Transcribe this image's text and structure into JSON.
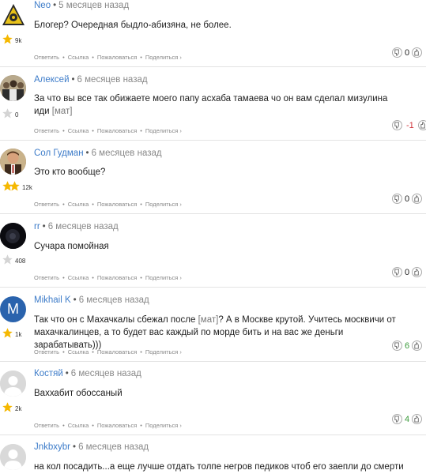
{
  "comments": [
    {
      "author": "Neo",
      "time": "5 месяцев назад",
      "text": "Блогер? Очередная быдло-абизяна, не более.",
      "karma": "9k",
      "rating": "0",
      "rating_kind": "zero",
      "avatar": "warning-triangle"
    },
    {
      "author": "Алексей",
      "time": "6 месяцев назад",
      "text": "За что вы все так обижаете моего папу асхаба тамаева чо он вам сделал мизулина иди",
      "text_mat": "[мат]",
      "karma": "0",
      "rating": "-1",
      "rating_kind": "neg",
      "avatar": "photo-group"
    },
    {
      "author": "Сол Гудман",
      "time": "6 месяцев назад",
      "text": "Это кто вообще?",
      "karma": "12k",
      "rating": "0",
      "rating_kind": "zero",
      "avatar": "photo-man"
    },
    {
      "author": "rr",
      "time": "6 месяцев назад",
      "text": "Сучара помойная",
      "karma": "408",
      "rating": "0",
      "rating_kind": "zero",
      "avatar": "dark-space"
    },
    {
      "author": "Mikhail K",
      "time": "6 месяцев назад",
      "text_a": "Так что он с Махачкалы сбежал после",
      "text_mat": "[мат]",
      "text_b": "? А в Москве крутой. Учитесь москвичи от махачкалинцев, а то будет вас каждый по морде бить и на вас же деньги зарабатывать)))",
      "karma": "1k",
      "rating": "6",
      "rating_kind": "pos",
      "avatar_letter": "M"
    },
    {
      "author": "Костяй",
      "time": "6 месяцев назад",
      "text": "Ваххабит обоссаный",
      "karma": "2k",
      "rating": "4",
      "rating_kind": "pos",
      "avatar": "default-user"
    },
    {
      "author": "Jnkbxybr",
      "time": "6 месяцев назад",
      "text": "на кол посадить...а еще лучше отдать толпе негров педиков чтоб его заепли до смерти",
      "avatar": "default-user"
    }
  ],
  "actions": {
    "reply": "Ответить",
    "link": "Ссылка",
    "report": "Пожаловаться",
    "share": "Поделиться ›"
  },
  "colors": {
    "author": "#3d7cc9",
    "negative": "#d0343a",
    "positive": "#3a9a3a",
    "star": "#f5b800",
    "avatar_blue": "#2a63ad"
  }
}
